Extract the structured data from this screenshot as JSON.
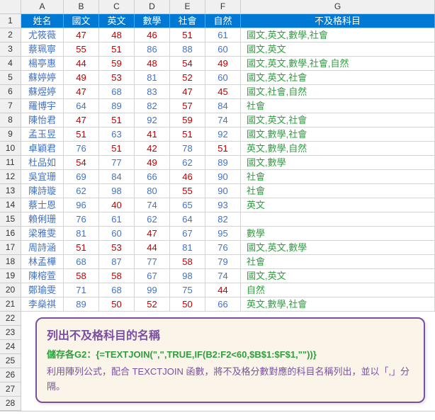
{
  "columns": [
    "A",
    "B",
    "C",
    "D",
    "E",
    "F",
    "G"
  ],
  "headers": {
    "name": "姓名",
    "chinese": "國文",
    "english": "英文",
    "math": "數學",
    "social": "社會",
    "science": "自然",
    "fail": "不及格科目"
  },
  "rows": [
    {
      "n": 2,
      "name": "尤筱薇",
      "s": [
        47,
        48,
        46,
        51,
        61
      ],
      "f": "國文,英文,數學,社會"
    },
    {
      "n": 3,
      "name": "蔡珮寧",
      "s": [
        55,
        51,
        86,
        88,
        60
      ],
      "f": "國文,英文"
    },
    {
      "n": 4,
      "name": "楊亭惠",
      "s": [
        44,
        59,
        48,
        54,
        49
      ],
      "f": "國文,英文,數學,社會,自然"
    },
    {
      "n": 5,
      "name": "蘇婷婷",
      "s": [
        49,
        53,
        81,
        52,
        60
      ],
      "f": "國文,英文,社會"
    },
    {
      "n": 6,
      "name": "蘇煜婷",
      "s": [
        47,
        68,
        83,
        47,
        45
      ],
      "f": "國文,社會,自然"
    },
    {
      "n": 7,
      "name": "羅博宇",
      "s": [
        64,
        89,
        82,
        57,
        84
      ],
      "f": "社會"
    },
    {
      "n": 8,
      "name": "陳怡君",
      "s": [
        47,
        51,
        92,
        59,
        74
      ],
      "f": "國文,英文,社會"
    },
    {
      "n": 9,
      "name": "孟玉昱",
      "s": [
        51,
        63,
        41,
        51,
        92
      ],
      "f": "國文,數學,社會"
    },
    {
      "n": 10,
      "name": "卓穎君",
      "s": [
        76,
        51,
        42,
        78,
        51
      ],
      "f": "英文,數學,自然"
    },
    {
      "n": 11,
      "name": "杜品如",
      "s": [
        54,
        77,
        49,
        62,
        89
      ],
      "f": "國文,數學"
    },
    {
      "n": 12,
      "name": "吳宜珊",
      "s": [
        69,
        84,
        66,
        46,
        90
      ],
      "f": "社會"
    },
    {
      "n": 13,
      "name": "陳詩璇",
      "s": [
        62,
        98,
        80,
        55,
        90
      ],
      "f": "社會"
    },
    {
      "n": 14,
      "name": "蔡士恩",
      "s": [
        96,
        40,
        74,
        65,
        93
      ],
      "f": "英文"
    },
    {
      "n": 15,
      "name": "賴俐珊",
      "s": [
        76,
        61,
        62,
        64,
        82
      ],
      "f": ""
    },
    {
      "n": 16,
      "name": "梁雅雯",
      "s": [
        81,
        60,
        47,
        67,
        95
      ],
      "f": "數學"
    },
    {
      "n": 17,
      "name": "周詩涵",
      "s": [
        51,
        53,
        44,
        81,
        76
      ],
      "f": "國文,英文,數學"
    },
    {
      "n": 18,
      "name": "林孟樺",
      "s": [
        68,
        87,
        77,
        58,
        79
      ],
      "f": "社會"
    },
    {
      "n": 19,
      "name": "陳榕萱",
      "s": [
        58,
        58,
        67,
        98,
        74
      ],
      "f": "國文,英文"
    },
    {
      "n": 20,
      "name": "鄭瑜雯",
      "s": [
        71,
        68,
        99,
        75,
        44
      ],
      "f": "自然"
    },
    {
      "n": 21,
      "name": "李燊祺",
      "s": [
        89,
        50,
        52,
        50,
        66
      ],
      "f": "英文,數學,社會"
    }
  ],
  "extraRowNums": [
    22,
    23,
    24,
    25,
    26,
    27,
    28
  ],
  "note": {
    "title": "列出不及格科目的名稱",
    "formula": "儲存各G2：{=TEXTJOIN(\",\",TRUE,IF(B2:F2<60,$B$1:$F$1,\"\"))}",
    "desc": "利用陣列公式，配合 TEXCTJOIN 函數，將不及格分數對應的科目名稱列出，並以「,」分隔。"
  },
  "chart_data": {
    "type": "table",
    "title": "學生成績與不及格科目",
    "columns": [
      "姓名",
      "國文",
      "英文",
      "數學",
      "社會",
      "自然",
      "不及格科目"
    ],
    "pass_threshold": 60,
    "rows": [
      [
        "尤筱薇",
        47,
        48,
        46,
        51,
        61,
        "國文,英文,數學,社會"
      ],
      [
        "蔡珮寧",
        55,
        51,
        86,
        88,
        60,
        "國文,英文"
      ],
      [
        "楊亭惠",
        44,
        59,
        48,
        54,
        49,
        "國文,英文,數學,社會,自然"
      ],
      [
        "蘇婷婷",
        49,
        53,
        81,
        52,
        60,
        "國文,英文,社會"
      ],
      [
        "蘇煜婷",
        47,
        68,
        83,
        47,
        45,
        "國文,社會,自然"
      ],
      [
        "羅博宇",
        64,
        89,
        82,
        57,
        84,
        "社會"
      ],
      [
        "陳怡君",
        47,
        51,
        92,
        59,
        74,
        "國文,英文,社會"
      ],
      [
        "孟玉昱",
        51,
        63,
        41,
        51,
        92,
        "國文,數學,社會"
      ],
      [
        "卓穎君",
        76,
        51,
        42,
        78,
        51,
        "英文,數學,自然"
      ],
      [
        "杜品如",
        54,
        77,
        49,
        62,
        89,
        "國文,數學"
      ],
      [
        "吳宜珊",
        69,
        84,
        66,
        46,
        90,
        "社會"
      ],
      [
        "陳詩璇",
        62,
        98,
        80,
        55,
        90,
        "社會"
      ],
      [
        "蔡士恩",
        96,
        40,
        74,
        65,
        93,
        "英文"
      ],
      [
        "賴俐珊",
        76,
        61,
        62,
        64,
        82,
        ""
      ],
      [
        "梁雅雯",
        81,
        60,
        47,
        67,
        95,
        "數學"
      ],
      [
        "周詩涵",
        51,
        53,
        44,
        81,
        76,
        "國文,英文,數學"
      ],
      [
        "林孟樺",
        68,
        87,
        77,
        58,
        79,
        "社會"
      ],
      [
        "陳榕萱",
        58,
        58,
        67,
        98,
        74,
        "國文,英文"
      ],
      [
        "鄭瑜雯",
        71,
        68,
        99,
        75,
        44,
        "自然"
      ],
      [
        "李燊祺",
        89,
        50,
        52,
        50,
        66,
        "英文,數學,社會"
      ]
    ]
  }
}
